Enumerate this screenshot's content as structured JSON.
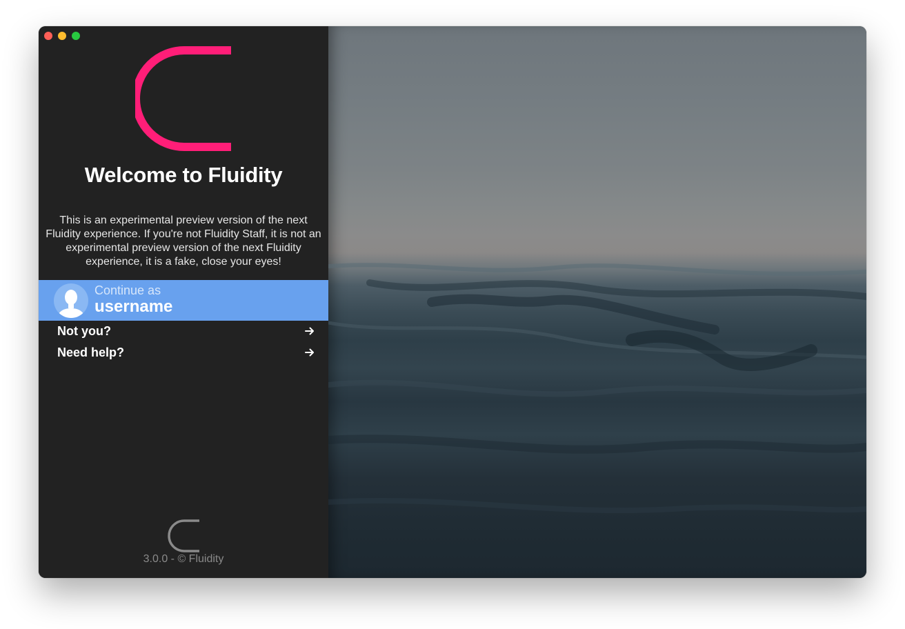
{
  "app": {
    "welcome_title": "Welcome to Fluidity",
    "description": "This is an experimental preview version of the next Fluidity experience. If you're not Fluidity Staff, it is not an experimental preview version of the next Fluidity experience, it is a fake, close your eyes!",
    "accent_color": "#ff1e78"
  },
  "account": {
    "continue_as": "Continue as",
    "username": "username",
    "highlight_color": "#68a1ee"
  },
  "links": {
    "not_you": "Not you?",
    "need_help": "Need help?"
  },
  "footer": {
    "version_text": "3.0.0 - © Fluidity"
  },
  "icons": {
    "logo": "fluidity-logo-icon",
    "avatar": "user-avatar-icon",
    "arrow": "arrow-right-icon"
  }
}
